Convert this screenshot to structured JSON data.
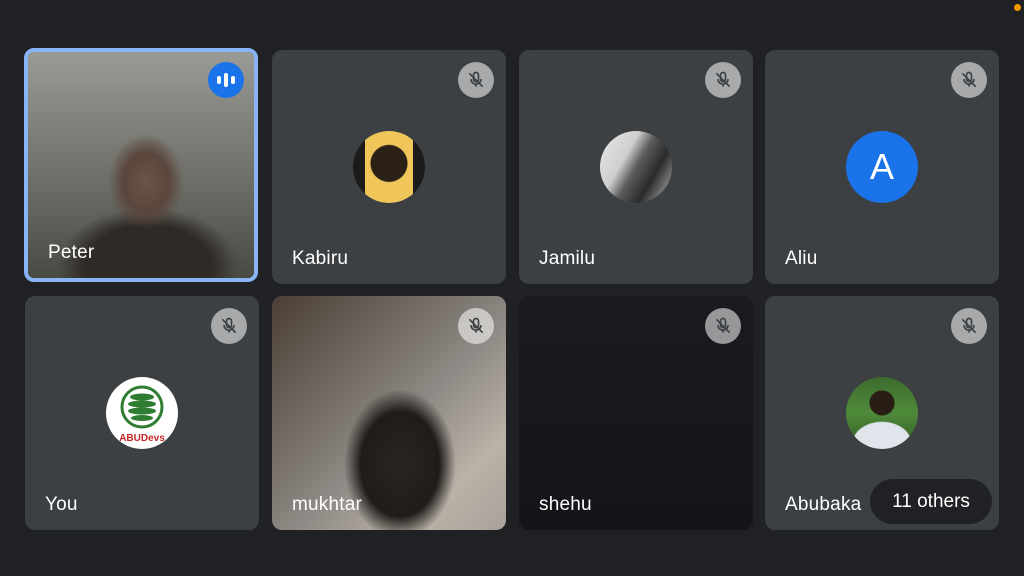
{
  "participants": [
    {
      "name": "Peter",
      "state": "speaking",
      "view": "video"
    },
    {
      "name": "Kabiru",
      "state": "muted",
      "view": "avatar-photo"
    },
    {
      "name": "Jamilu",
      "state": "muted",
      "view": "avatar-photo"
    },
    {
      "name": "Aliu",
      "state": "muted",
      "view": "avatar-letter",
      "initial": "A"
    },
    {
      "name": "You",
      "state": "muted",
      "view": "avatar-logo",
      "logo_text": "ABUDevs"
    },
    {
      "name": "mukhtar",
      "state": "muted",
      "view": "video"
    },
    {
      "name": "shehu",
      "state": "muted",
      "view": "video"
    },
    {
      "name": "Abubaka",
      "state": "muted",
      "view": "avatar-photo"
    }
  ],
  "others_label": "11 others",
  "colors": {
    "background": "#202124",
    "tile": "#3c4043",
    "active_border": "#8ab4f8",
    "speaking_badge": "#1a73e8",
    "avatar_letter_bg": "#1a73e8"
  },
  "icons": {
    "muted": "mic-off-icon",
    "speaking": "audio-level-icon"
  }
}
